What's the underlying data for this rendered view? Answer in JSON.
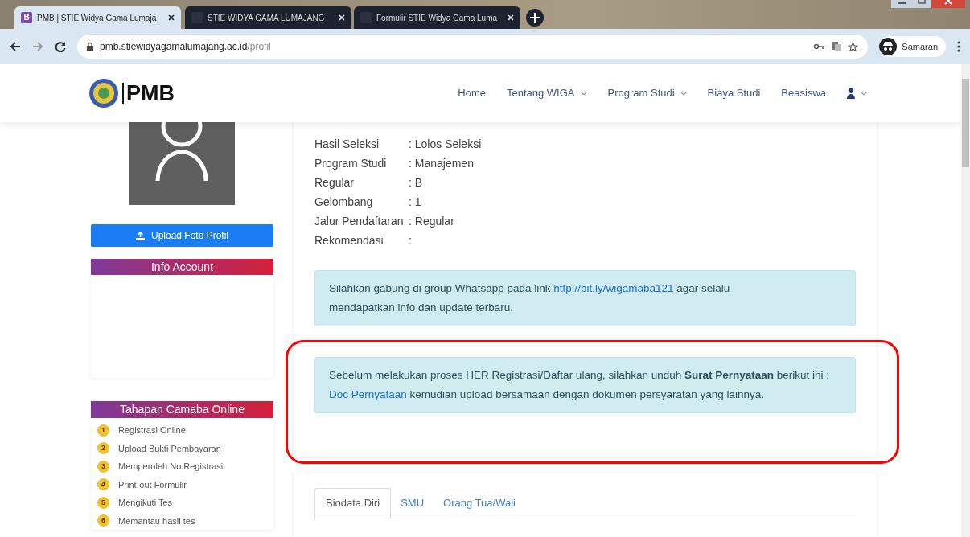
{
  "browser": {
    "tabs": [
      {
        "icon_letter": "B",
        "title": "PMB | STIE Widya Gama Lumaja",
        "selected": true
      },
      {
        "title": "STIE WIDYA GAMA LUMAJANG",
        "selected": false
      },
      {
        "title": "Formulir STIE Widya Gama Luma",
        "selected": false
      }
    ],
    "url_host": "pmb.stiewidyagamalumajang.ac.id",
    "url_path": "/profil",
    "profile_label": "Samaran"
  },
  "navbar": {
    "brand": "PMB",
    "items": [
      {
        "label": "Home",
        "dropdown": false
      },
      {
        "label": "Tentang WIGA",
        "dropdown": true
      },
      {
        "label": "Program Studi",
        "dropdown": true
      },
      {
        "label": "Biaya Studi",
        "dropdown": false
      },
      {
        "label": "Beasiswa",
        "dropdown": false
      }
    ]
  },
  "sidebar": {
    "upload_button": "Upload Foto Profil",
    "info_account_title": "Info Account",
    "steps_title": "Tahapan Camaba Online",
    "steps": [
      {
        "number": "1",
        "label": "Registrasi Online"
      },
      {
        "number": "2",
        "label": "Upload Bukti Pembayaran"
      },
      {
        "number": "3",
        "label": "Memperoleh No.Registrasi"
      },
      {
        "number": "4",
        "label": "Print-out Formulir"
      },
      {
        "number": "5",
        "label": "Mengikuti Tes"
      },
      {
        "number": "6",
        "label": "Memantau hasil tes"
      }
    ]
  },
  "profile": {
    "fields": [
      {
        "label": "Hasil Seleksi",
        "value": ": Lolos Seleksi"
      },
      {
        "label": "Program Studi",
        "value": ": Manajemen"
      },
      {
        "label": "Regular",
        "value": ": B"
      },
      {
        "label": "Gelombang",
        "value": ": 1"
      },
      {
        "label": "Jalur Pendaftaran",
        "value": ": Regular"
      },
      {
        "label": "Rekomendasi",
        "value": ":"
      }
    ]
  },
  "alerts": [
    {
      "before": "Silahkan gabung di group Whatsapp pada link ",
      "link": "http://bit.ly/wigamaba121",
      "after": " agar selalu mendapatkan info dan update terbaru.",
      "highlighted": false
    },
    {
      "before": "Sebelum melakukan proses HER Registrasi/Daftar ulang, silahkan unduh **Surat Pernyataan** berikut ini : ",
      "link": "Doc Pernyataan",
      "after": " kemudian upload bersamaan dengan dokumen persyaratan yang lainnya.",
      "highlighted": true
    }
  ],
  "detail_tabs": [
    {
      "label": "Biodata Diri",
      "selected": true
    },
    {
      "label": "SMU",
      "selected": false
    },
    {
      "label": "Orang Tua/Wali",
      "selected": false
    }
  ]
}
